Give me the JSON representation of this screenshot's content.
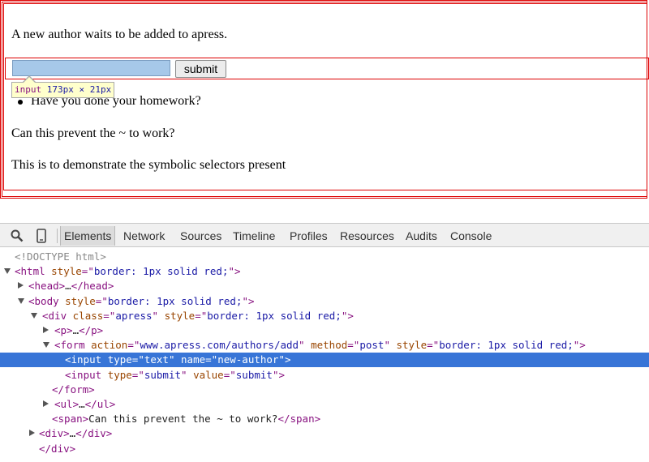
{
  "page": {
    "paragraph_1": "A new author waits to be added to apress.",
    "input_value": "",
    "submit_label": "submit",
    "list_item": "Have you done your homework?",
    "span_text": "Can this prevent the ~ to work?",
    "paragraph_2": "This is to demonstrate the symbolic selectors present",
    "tooltip": {
      "tag": "input",
      "dims": "173px × 21px"
    },
    "border_color": "#dd0000",
    "input_highlight_color": "#a6c8e9"
  },
  "devtools": {
    "icons": [
      "search-icon",
      "device-mode-icon"
    ],
    "tabs": [
      "Elements",
      "Network",
      "Sources",
      "Timeline",
      "Profiles",
      "Resources",
      "Audits",
      "Console"
    ],
    "active_tab": "Elements",
    "selection_color": "#3875d7",
    "lines": [
      [
        {
          "c": "cmt",
          "t": "<!DOCTYPE html>"
        }
      ],
      [
        {
          "c": "tag",
          "t": "<html "
        },
        {
          "c": "attr",
          "t": "style"
        },
        {
          "c": "tag",
          "t": "=\""
        },
        {
          "c": "val",
          "t": "border: 1px solid red;"
        },
        {
          "c": "tag",
          "t": "\">"
        }
      ],
      [
        {
          "c": "tag",
          "t": "<head>"
        },
        {
          "c": "txt",
          "t": "…"
        },
        {
          "c": "tag",
          "t": "</head>"
        }
      ],
      [
        {
          "c": "tag",
          "t": "<body "
        },
        {
          "c": "attr",
          "t": "style"
        },
        {
          "c": "tag",
          "t": "=\""
        },
        {
          "c": "val",
          "t": "border: 1px solid red;"
        },
        {
          "c": "tag",
          "t": "\">"
        }
      ],
      [
        {
          "c": "tag",
          "t": "<div "
        },
        {
          "c": "attr",
          "t": "class"
        },
        {
          "c": "tag",
          "t": "=\""
        },
        {
          "c": "val",
          "t": "apress"
        },
        {
          "c": "tag",
          "t": "\" "
        },
        {
          "c": "attr",
          "t": "style"
        },
        {
          "c": "tag",
          "t": "=\""
        },
        {
          "c": "val",
          "t": "border: 1px solid red;"
        },
        {
          "c": "tag",
          "t": "\">"
        }
      ],
      [
        {
          "c": "tag",
          "t": "<p>"
        },
        {
          "c": "txt",
          "t": "…"
        },
        {
          "c": "tag",
          "t": "</p>"
        }
      ],
      [
        {
          "c": "tag",
          "t": "<form "
        },
        {
          "c": "attr",
          "t": "action"
        },
        {
          "c": "tag",
          "t": "=\""
        },
        {
          "c": "val",
          "t": "www.apress.com/authors/add"
        },
        {
          "c": "tag",
          "t": "\" "
        },
        {
          "c": "attr",
          "t": "method"
        },
        {
          "c": "tag",
          "t": "=\""
        },
        {
          "c": "val",
          "t": "post"
        },
        {
          "c": "tag",
          "t": "\" "
        },
        {
          "c": "attr",
          "t": "style"
        },
        {
          "c": "tag",
          "t": "=\""
        },
        {
          "c": "val",
          "t": "border: 1px solid red;"
        },
        {
          "c": "tag",
          "t": "\">"
        }
      ],
      [
        {
          "c": "tag",
          "t": "<input "
        },
        {
          "c": "attr",
          "t": "type"
        },
        {
          "c": "tag",
          "t": "=\""
        },
        {
          "c": "val",
          "t": "text"
        },
        {
          "c": "tag",
          "t": "\" "
        },
        {
          "c": "attr",
          "t": "name"
        },
        {
          "c": "tag",
          "t": "=\""
        },
        {
          "c": "val",
          "t": "new-author"
        },
        {
          "c": "tag",
          "t": "\">"
        }
      ],
      [
        {
          "c": "tag",
          "t": "<input "
        },
        {
          "c": "attr",
          "t": "type"
        },
        {
          "c": "tag",
          "t": "=\""
        },
        {
          "c": "val",
          "t": "submit"
        },
        {
          "c": "tag",
          "t": "\" "
        },
        {
          "c": "attr",
          "t": "value"
        },
        {
          "c": "tag",
          "t": "=\""
        },
        {
          "c": "val",
          "t": "submit"
        },
        {
          "c": "tag",
          "t": "\">"
        }
      ],
      [
        {
          "c": "tag",
          "t": "</form>"
        }
      ],
      [
        {
          "c": "tag",
          "t": "<ul>"
        },
        {
          "c": "txt",
          "t": "…"
        },
        {
          "c": "tag",
          "t": "</ul>"
        }
      ],
      [
        {
          "c": "tag",
          "t": "<span>"
        },
        {
          "c": "txt",
          "t": "Can this prevent the ~ to work?"
        },
        {
          "c": "tag",
          "t": "</span>"
        }
      ],
      [
        {
          "c": "tag",
          "t": "<div>"
        },
        {
          "c": "txt",
          "t": "…"
        },
        {
          "c": "tag",
          "t": "</div>"
        }
      ],
      [
        {
          "c": "tag",
          "t": "</div>"
        }
      ]
    ],
    "line_arrows": [
      "none",
      "down",
      "right",
      "down",
      "down",
      "right",
      "down",
      "none",
      "none",
      "none",
      "right",
      "none",
      "right",
      "none"
    ],
    "selected_line": 7
  }
}
